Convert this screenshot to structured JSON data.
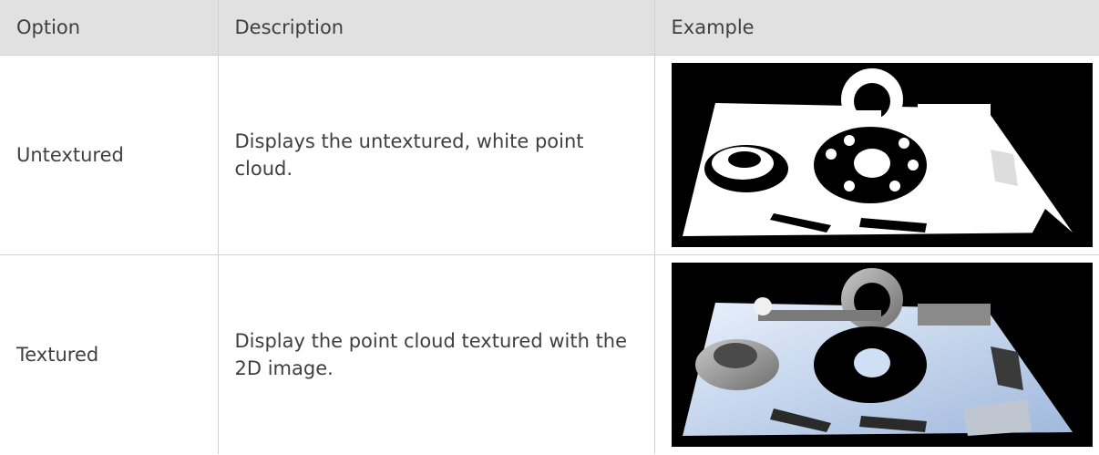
{
  "table": {
    "headers": [
      "Option",
      "Description",
      "Example"
    ],
    "rows": [
      {
        "option": "Untextured",
        "description": "Displays the untextured, white point cloud.",
        "example": "untextured point cloud image"
      },
      {
        "option": "Textured",
        "description": "Display the point cloud textured with the 2D image.",
        "example": "textured point cloud image"
      }
    ]
  }
}
